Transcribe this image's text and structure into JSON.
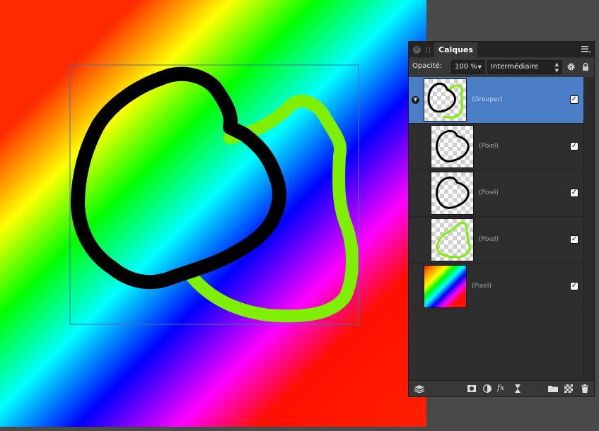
{
  "panel": {
    "tab_label": "Calques",
    "opacity_label": "Opacité:",
    "opacity_value": "100 %",
    "blend_mode": "Intermédiaire"
  },
  "layers": [
    {
      "name": "(Grouper)",
      "selected": true,
      "visible": true,
      "thumbnail": "group-outlines"
    },
    {
      "name": "(Pixel)",
      "selected": false,
      "visible": true,
      "thumbnail": "black-outline"
    },
    {
      "name": "(Pixel)",
      "selected": false,
      "visible": true,
      "thumbnail": "black-outline"
    },
    {
      "name": "(Pixel)",
      "selected": false,
      "visible": true,
      "thumbnail": "green-outline"
    },
    {
      "name": "(Pixel)",
      "selected": false,
      "visible": true,
      "thumbnail": "rainbow-gradient"
    }
  ],
  "footer_icons": [
    "layers-stack-icon",
    "mask-icon",
    "adjustment-icon",
    "fx-icon",
    "live-filter-icon",
    "folder-icon",
    "add-pixel-layer-icon",
    "trash-icon"
  ],
  "colors": {
    "selection_blue": "#4a7fc8",
    "stroke_green": "#7fef00",
    "stroke_black": "#000000",
    "panel_bg": "#2e2e2e"
  }
}
